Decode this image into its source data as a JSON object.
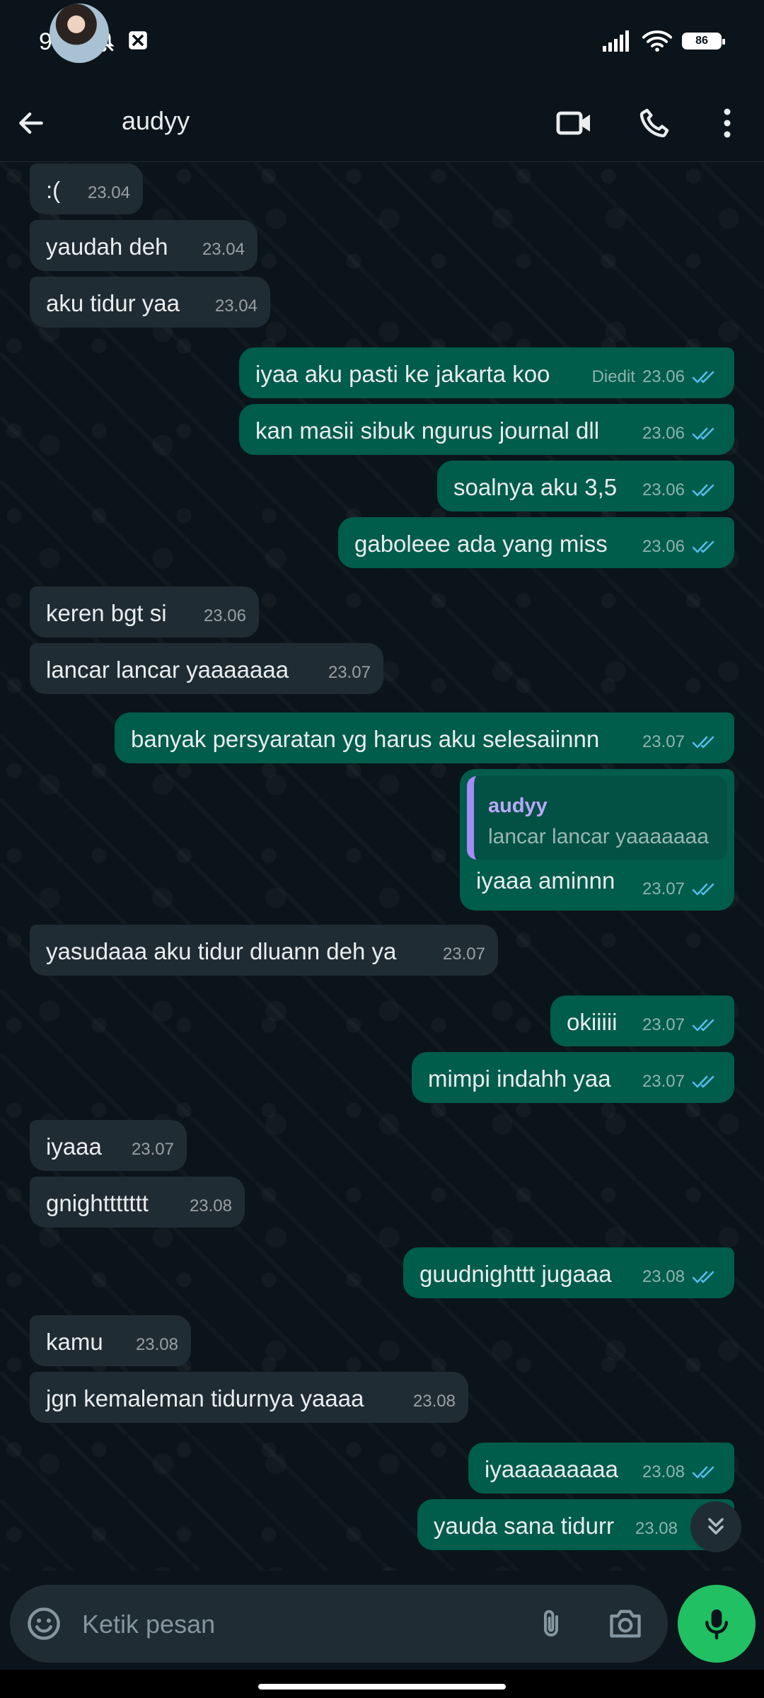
{
  "status": {
    "time": "9:02",
    "battery": "86"
  },
  "header": {
    "contact_name": "audyy"
  },
  "messages": [
    {
      "text": ":(",
      "time": "23.04"
    },
    {
      "text": "yaudah deh",
      "time": "23.04"
    },
    {
      "text": "aku tidur yaa",
      "time": "23.04"
    },
    {
      "text": "iyaa aku pasti ke jakarta koo",
      "time": "23.06",
      "edited": "Diedit"
    },
    {
      "text": "kan masii sibuk ngurus journal dll",
      "time": "23.06"
    },
    {
      "text": "soalnya aku 3,5",
      "time": "23.06"
    },
    {
      "text": "gaboleee ada yang miss",
      "time": "23.06"
    },
    {
      "text": "keren bgt si",
      "time": "23.06"
    },
    {
      "text": "lancar lancar yaaaaaaa",
      "time": "23.07"
    },
    {
      "text": "banyak persyaratan yg harus aku selesaiinnn",
      "time": "23.07"
    },
    {
      "text": "iyaaa aminnn",
      "time": "23.07",
      "quote_name": "audyy",
      "quote_text": "lancar lancar yaaaaaaa"
    },
    {
      "text": "yasudaaa aku tidur dluann deh ya",
      "time": "23.07"
    },
    {
      "text": "okiiiii",
      "time": "23.07"
    },
    {
      "text": "mimpi indahh yaa",
      "time": "23.07"
    },
    {
      "text": "iyaaa",
      "time": "23.07"
    },
    {
      "text": "gnighttttttt",
      "time": "23.08"
    },
    {
      "text": "guudnighttt jugaaa",
      "time": "23.08"
    },
    {
      "text": "kamu",
      "time": "23.08"
    },
    {
      "text": "jgn kemaleman tidurnya yaaaa",
      "time": "23.08"
    },
    {
      "text": "iyaaaaaaaaa",
      "time": "23.08"
    },
    {
      "text": "yauda sana tidurr",
      "time": "23.08"
    }
  ],
  "composer": {
    "placeholder": "Ketik pesan"
  },
  "colors": {
    "background": "#0b141a",
    "incoming_bubble": "#202c33",
    "outgoing_bubble": "#005c4b",
    "read_ticks": "#53bdeb",
    "mic_button": "#21c063"
  }
}
